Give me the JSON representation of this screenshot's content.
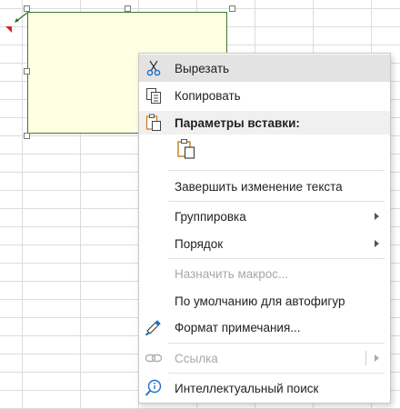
{
  "menu": {
    "items": [
      {
        "label": "Вырезать",
        "icon": "scissors-icon"
      },
      {
        "label": "Копировать",
        "icon": "copy-icon"
      },
      {
        "label": "Параметры вставки:",
        "icon": "paste-icon"
      },
      {
        "label": "Завершить изменение текста"
      },
      {
        "label": "Группировка",
        "submenu": true
      },
      {
        "label": "Порядок",
        "submenu": true
      },
      {
        "label": "Назначить макрос...",
        "disabled": true
      },
      {
        "label": "По умолчанию для автофигур"
      },
      {
        "label": "Формат примечания...",
        "icon": "format-shape-icon"
      },
      {
        "label": "Ссылка",
        "icon": "link-icon",
        "disabled": true,
        "submenu": true
      },
      {
        "label": "Интеллектуальный поиск",
        "icon": "smart-lookup-icon"
      }
    ],
    "paste_options": [
      {
        "icon": "paste-keep-formatting-icon"
      }
    ]
  },
  "colors": {
    "comment_fill": "#ffffe1",
    "comment_border": "#3a7a3a",
    "highlight": "#e3e3e3",
    "disabled_text": "#a8a8a8",
    "indicator_red": "#e02020"
  }
}
